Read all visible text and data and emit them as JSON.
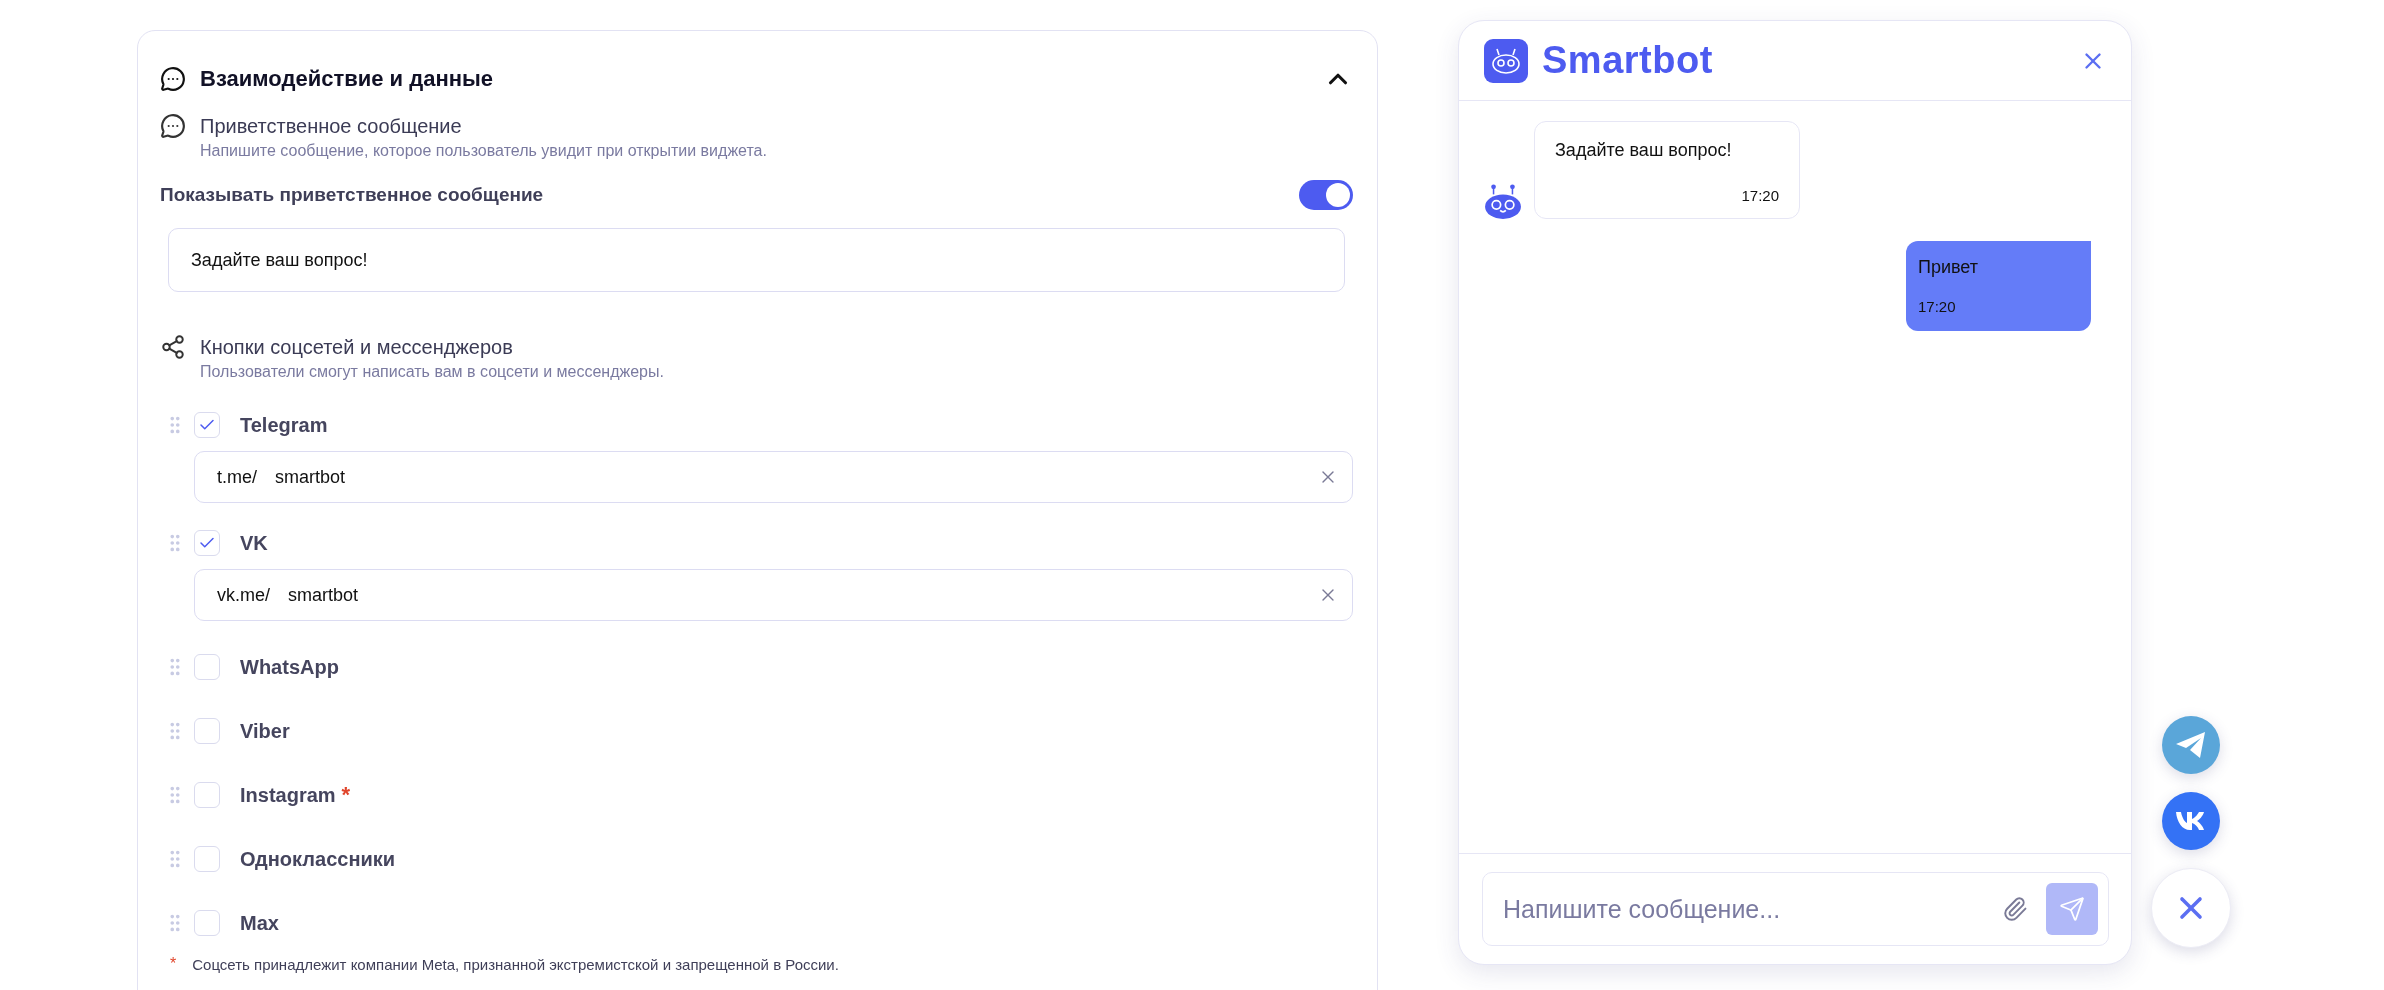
{
  "section": {
    "title": "Взаимодействие и данные",
    "expanded": true
  },
  "greeting": {
    "title": "Приветственное сообщение",
    "description": "Напишите сообщение, которое пользователь увидит при открытии виджета.",
    "toggle_label": "Показывать приветственное сообщение",
    "show": true,
    "value": "Задайте ваш вопрос!"
  },
  "socials": {
    "title": "Кнопки соцсетей и мессенджеров",
    "description": "Пользователи смогут написать вам в соцсети и мессенджеры.",
    "items": [
      {
        "label": "Telegram",
        "checked": true,
        "prefix": "t.me/",
        "value": "smartbot"
      },
      {
        "label": "VK",
        "checked": true,
        "prefix": "vk.me/",
        "value": "smartbot"
      },
      {
        "label": "WhatsApp",
        "checked": false
      },
      {
        "label": "Viber",
        "checked": false
      },
      {
        "label": "Instagram",
        "checked": false,
        "mark": "*"
      },
      {
        "label": "Одноклассники",
        "checked": false
      },
      {
        "label": "Max",
        "checked": false
      }
    ]
  },
  "footnote": {
    "mark": "*",
    "text": "Соцсеть принадлежит компании Meta, признанной экстремистской и запрещенной в России."
  },
  "chat": {
    "brand": "Smartbot",
    "messages": [
      {
        "kind": "bot",
        "text": "Задайте ваш вопрос!",
        "time": "17:20"
      },
      {
        "kind": "user",
        "text": "Привет",
        "time": "17:20"
      }
    ],
    "composer": {
      "placeholder": "Напишите сообщение..."
    }
  },
  "launcher": [
    {
      "kind": "telegram"
    },
    {
      "kind": "vk"
    },
    {
      "kind": "close"
    }
  ]
}
